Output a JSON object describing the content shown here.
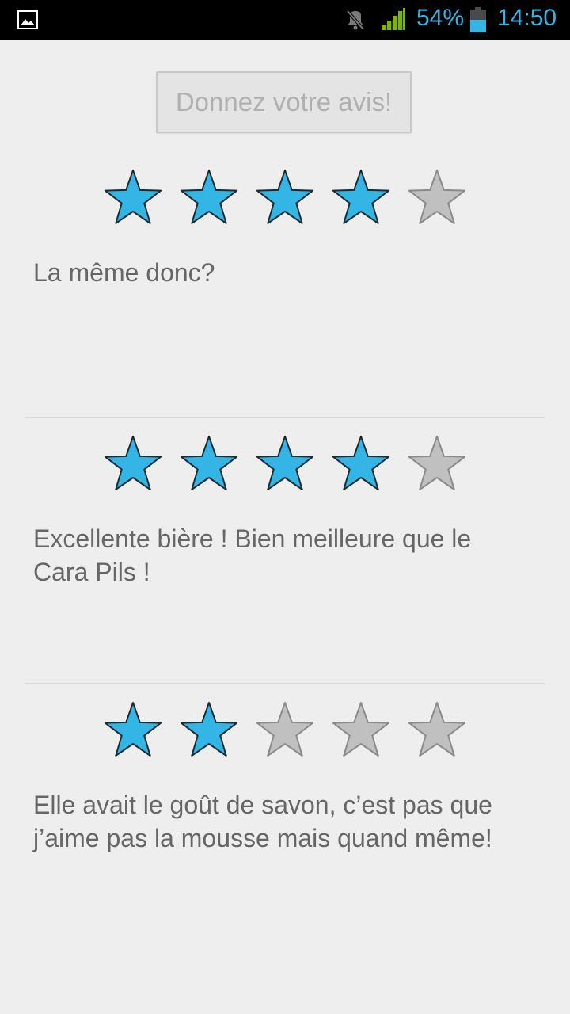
{
  "status_bar": {
    "battery_percent": "54%",
    "time": "14:50",
    "icons": [
      "gallery-icon",
      "mute-icon",
      "signal-icon",
      "battery-icon"
    ],
    "accent_color": "#33b5e5"
  },
  "button": {
    "label": "Donnez votre avis!"
  },
  "colors": {
    "star_filled": "#33b5e5",
    "star_empty": "#c0c0c0",
    "text": "#666666",
    "background": "#eeeeee"
  },
  "reviews": [
    {
      "rating": 4,
      "max_rating": 5,
      "text": "La même donc?"
    },
    {
      "rating": 4,
      "max_rating": 5,
      "text": "Excellente bière ! Bien meilleure que le Cara Pils !"
    },
    {
      "rating": 2,
      "max_rating": 5,
      "text": "Elle avait le goût de savon, c’est pas que j’aime pas la mousse mais quand même!"
    }
  ]
}
